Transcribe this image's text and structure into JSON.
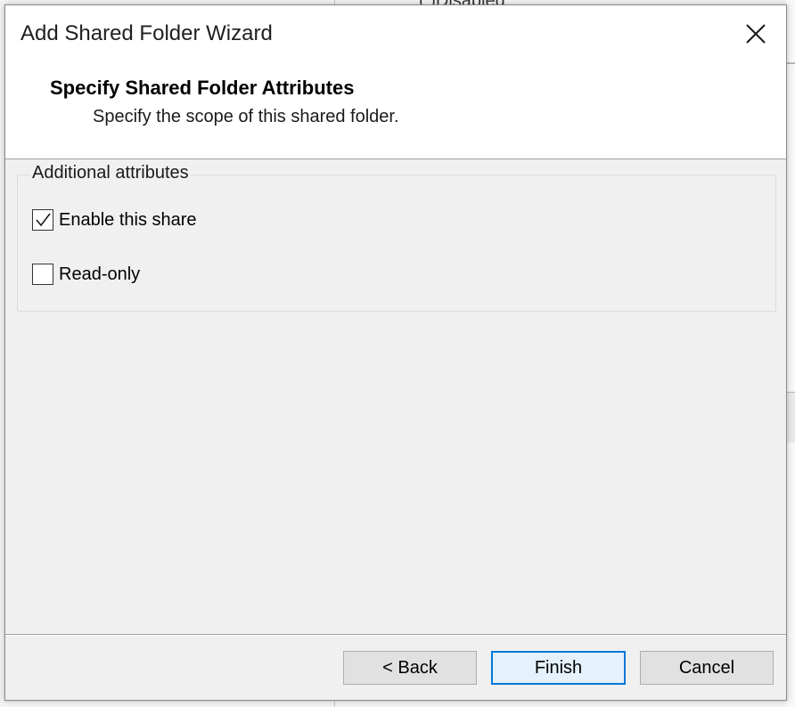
{
  "background": {
    "fragment_text": "( )Disabled"
  },
  "dialog": {
    "title": "Add Shared Folder Wizard",
    "close_icon": "close-icon"
  },
  "header": {
    "title": "Specify Shared Folder Attributes",
    "subtitle": "Specify the scope of this shared folder."
  },
  "attributes": {
    "group_label": "Additional attributes",
    "options": [
      {
        "label": "Enable this share",
        "checked": true
      },
      {
        "label": "Read-only",
        "checked": false
      }
    ]
  },
  "buttons": {
    "back": "< Back",
    "finish": "Finish",
    "cancel": "Cancel"
  },
  "colors": {
    "accent": "#0078d7",
    "dialog_bg": "#f0f0f0",
    "header_bg": "#ffffff"
  }
}
